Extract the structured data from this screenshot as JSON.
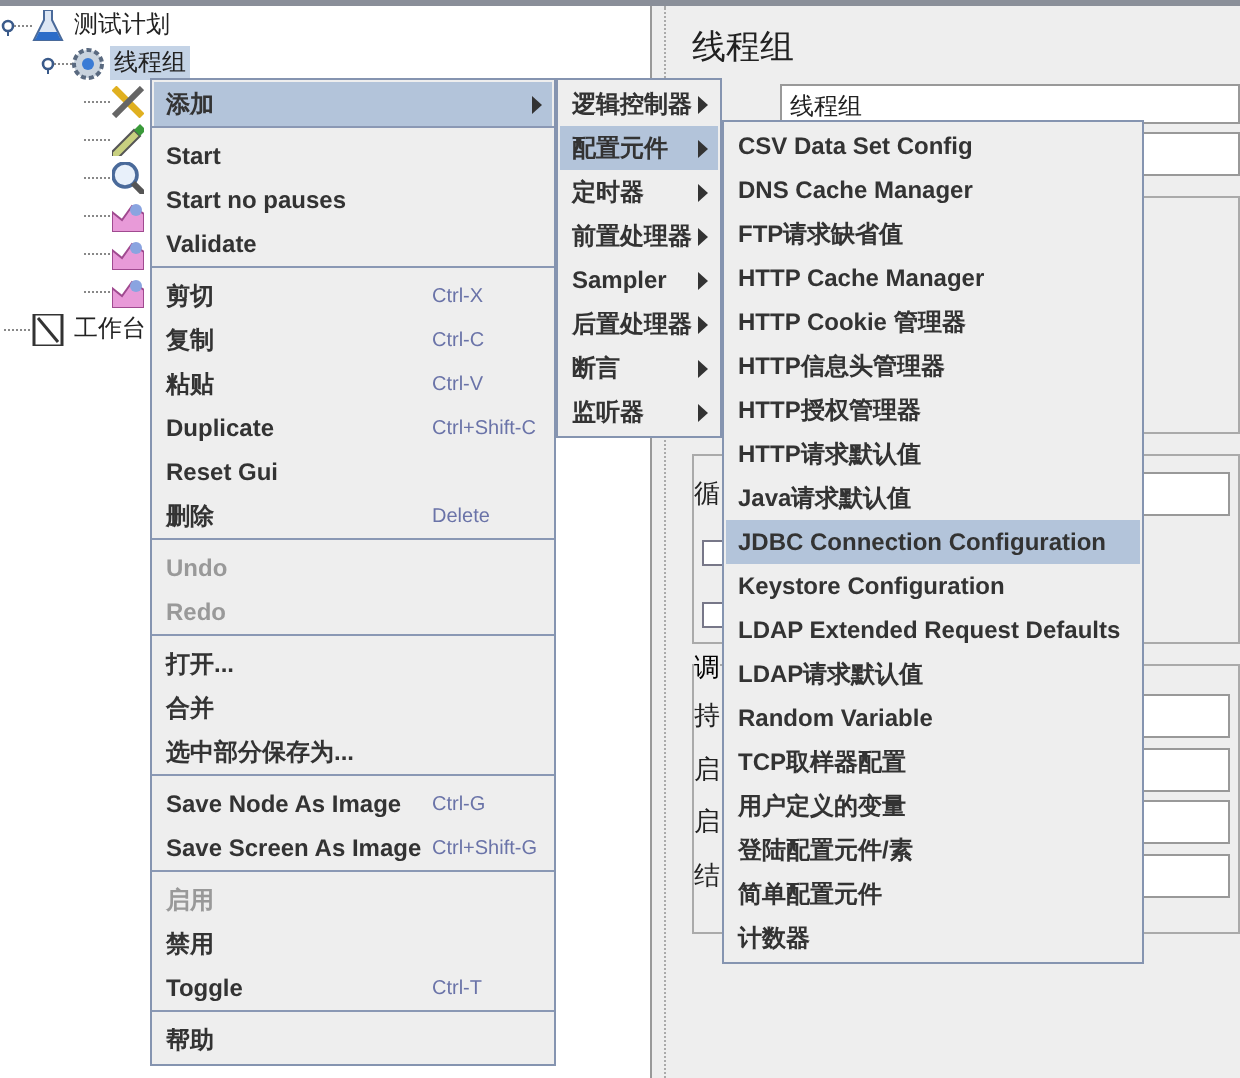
{
  "tree": {
    "items": [
      {
        "label": "测试计划",
        "kind": "flask",
        "selected": false,
        "expanded": true,
        "children": [
          {
            "label": "线程组",
            "kind": "gear",
            "selected": true,
            "expanded": true,
            "children": [
              {
                "kind": "tools"
              },
              {
                "kind": "pencil"
              },
              {
                "kind": "magnifier"
              },
              {
                "kind": "chart"
              },
              {
                "kind": "chart"
              },
              {
                "kind": "chart"
              }
            ]
          }
        ]
      },
      {
        "label": "工作台",
        "kind": "notepad",
        "selected": false
      }
    ]
  },
  "panel": {
    "title": "线程组",
    "name_value": "线程组",
    "loop_label": "循",
    "checkboxes": [
      {
        "checked": false
      },
      {
        "checked": false
      }
    ],
    "scheduler": {
      "title": "调",
      "rows": [
        {
          "label": "持"
        },
        {
          "label": "启"
        },
        {
          "label": "启"
        },
        {
          "label": "结"
        }
      ]
    }
  },
  "context_menu": {
    "items": [
      {
        "kind": "item",
        "label": "添加",
        "submenu": true,
        "selected": true,
        "disabled": false
      },
      {
        "kind": "separator"
      },
      {
        "kind": "item",
        "label": "Start",
        "selected": false,
        "disabled": false
      },
      {
        "kind": "item",
        "label": "Start no pauses",
        "selected": false,
        "disabled": false
      },
      {
        "kind": "item",
        "label": "Validate",
        "selected": false,
        "disabled": false
      },
      {
        "kind": "separator"
      },
      {
        "kind": "item",
        "label": "剪切",
        "shortcut": "Ctrl-X",
        "selected": false,
        "disabled": false
      },
      {
        "kind": "item",
        "label": "复制",
        "shortcut": "Ctrl-C",
        "selected": false,
        "disabled": false
      },
      {
        "kind": "item",
        "label": "粘贴",
        "shortcut": "Ctrl-V",
        "selected": false,
        "disabled": false
      },
      {
        "kind": "item",
        "label": "Duplicate",
        "shortcut": "Ctrl+Shift-C",
        "selected": false,
        "disabled": false
      },
      {
        "kind": "item",
        "label": "Reset Gui",
        "selected": false,
        "disabled": false
      },
      {
        "kind": "item",
        "label": "删除",
        "shortcut": "Delete",
        "selected": false,
        "disabled": false
      },
      {
        "kind": "separator"
      },
      {
        "kind": "item",
        "label": "Undo",
        "selected": false,
        "disabled": true
      },
      {
        "kind": "item",
        "label": "Redo",
        "selected": false,
        "disabled": true
      },
      {
        "kind": "separator"
      },
      {
        "kind": "item",
        "label": "打开...",
        "selected": false,
        "disabled": false
      },
      {
        "kind": "item",
        "label": "合并",
        "selected": false,
        "disabled": false
      },
      {
        "kind": "item",
        "label": "选中部分保存为...",
        "selected": false,
        "disabled": false
      },
      {
        "kind": "separator"
      },
      {
        "kind": "item",
        "label": "Save Node As Image",
        "shortcut": "Ctrl-G",
        "selected": false,
        "disabled": false
      },
      {
        "kind": "item",
        "label": "Save Screen As Image",
        "shortcut": "Ctrl+Shift-G",
        "selected": false,
        "disabled": false
      },
      {
        "kind": "separator"
      },
      {
        "kind": "item",
        "label": "启用",
        "selected": false,
        "disabled": true
      },
      {
        "kind": "item",
        "label": "禁用",
        "selected": false,
        "disabled": false
      },
      {
        "kind": "item",
        "label": "Toggle",
        "shortcut": "Ctrl-T",
        "selected": false,
        "disabled": false
      },
      {
        "kind": "separator"
      },
      {
        "kind": "item",
        "label": "帮助",
        "selected": false,
        "disabled": false
      }
    ]
  },
  "add_submenu": {
    "items": [
      {
        "label": "逻辑控制器",
        "submenu": true,
        "selected": false
      },
      {
        "label": "配置元件",
        "submenu": true,
        "selected": true
      },
      {
        "label": "定时器",
        "submenu": true,
        "selected": false
      },
      {
        "label": "前置处理器",
        "submenu": true,
        "selected": false
      },
      {
        "label": "Sampler",
        "submenu": true,
        "selected": false
      },
      {
        "label": "后置处理器",
        "submenu": true,
        "selected": false
      },
      {
        "label": "断言",
        "submenu": true,
        "selected": false
      },
      {
        "label": "监听器",
        "submenu": true,
        "selected": false
      }
    ]
  },
  "config_submenu": {
    "items": [
      {
        "label": "CSV Data Set Config",
        "selected": false
      },
      {
        "label": "DNS Cache Manager",
        "selected": false
      },
      {
        "label": "FTP请求缺省值",
        "selected": false
      },
      {
        "label": "HTTP Cache Manager",
        "selected": false
      },
      {
        "label": "HTTP Cookie 管理器",
        "selected": false
      },
      {
        "label": "HTTP信息头管理器",
        "selected": false
      },
      {
        "label": "HTTP授权管理器",
        "selected": false
      },
      {
        "label": "HTTP请求默认值",
        "selected": false
      },
      {
        "label": "Java请求默认值",
        "selected": false
      },
      {
        "label": "JDBC Connection Configuration",
        "selected": true
      },
      {
        "label": "Keystore Configuration",
        "selected": false
      },
      {
        "label": "LDAP Extended Request Defaults",
        "selected": false
      },
      {
        "label": "LDAP请求默认值",
        "selected": false
      },
      {
        "label": "Random Variable",
        "selected": false
      },
      {
        "label": "TCP取样器配置",
        "selected": false
      },
      {
        "label": "用户定义的变量",
        "selected": false
      },
      {
        "label": "登陆配置元件/素",
        "selected": false
      },
      {
        "label": "简单配置元件",
        "selected": false
      },
      {
        "label": "计数器",
        "selected": false
      }
    ]
  }
}
